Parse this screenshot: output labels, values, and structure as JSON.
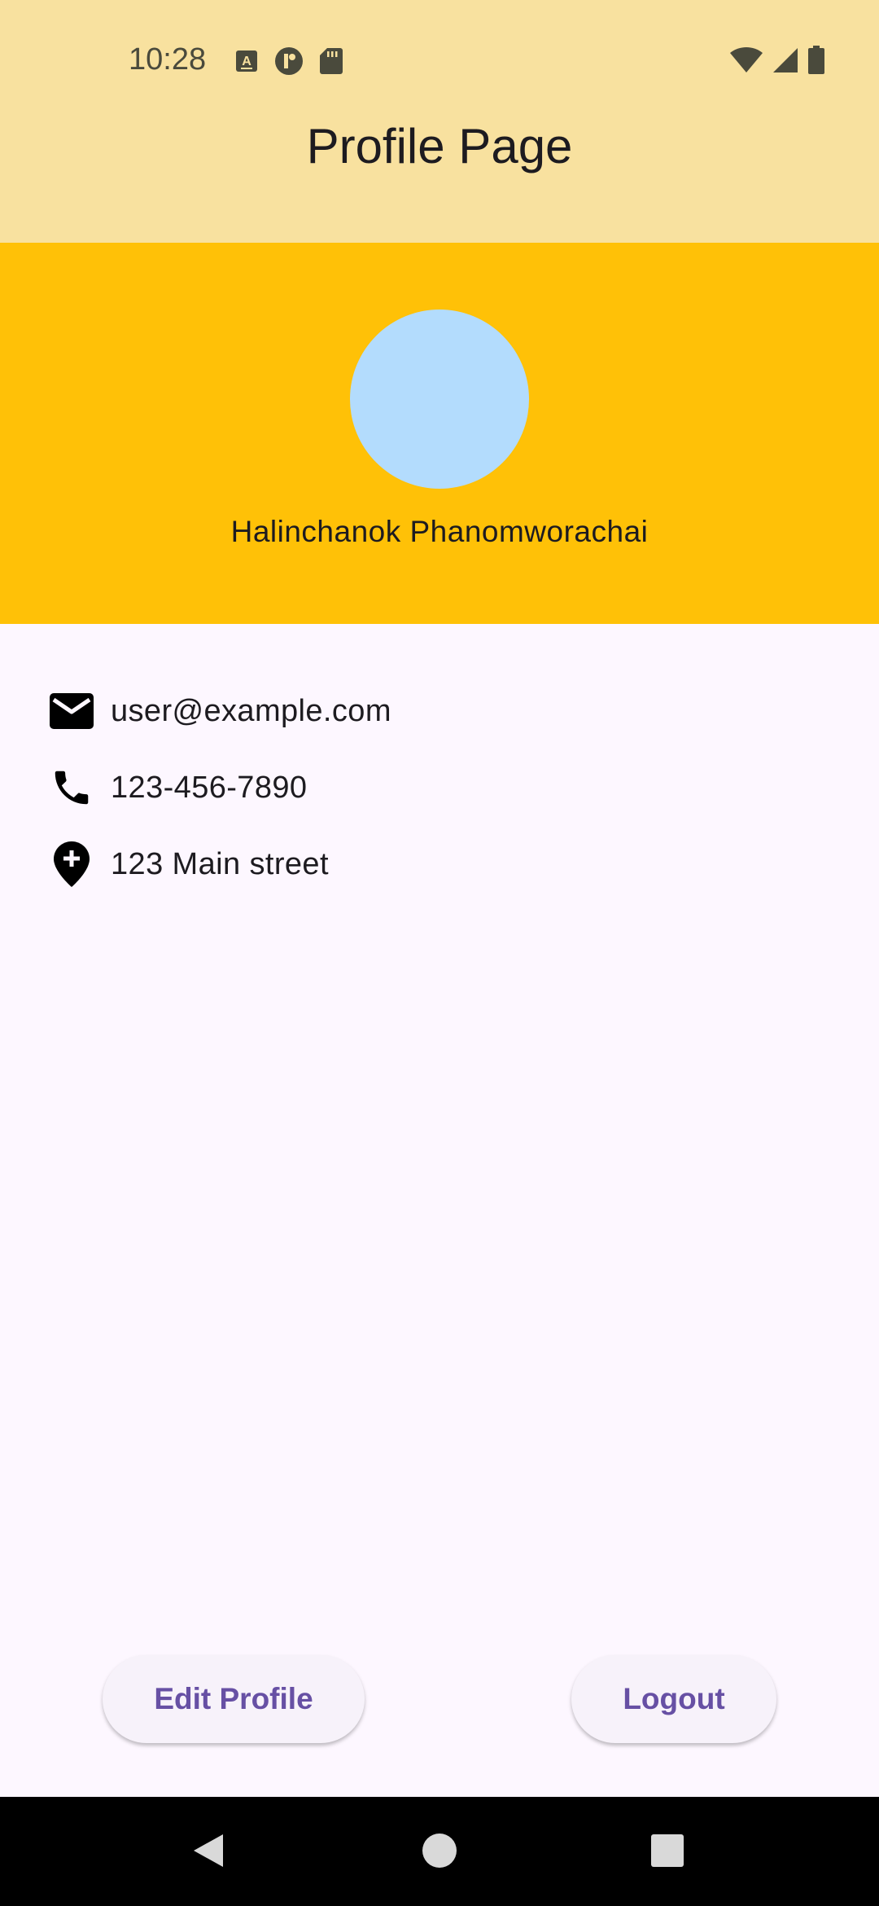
{
  "status_bar": {
    "time": "10:28",
    "left_icons": [
      "keyboard-icon",
      "app-badge-icon",
      "sd-card-icon"
    ],
    "right_icons": [
      "wifi-icon",
      "signal-icon",
      "battery-icon"
    ]
  },
  "app_bar": {
    "title": "Profile Page"
  },
  "profile": {
    "name": "Halinchanok Phanomworachai",
    "avatar_color": "#b3dcfd",
    "header_color": "#ffc107"
  },
  "contact": [
    {
      "icon": "mail-icon",
      "text": "user@example.com"
    },
    {
      "icon": "phone-icon",
      "text": "123-456-7890"
    },
    {
      "icon": "add-location-icon",
      "text": "123 Main street"
    }
  ],
  "actions": {
    "edit_label": "Edit Profile",
    "logout_label": "Logout"
  },
  "nav": {
    "buttons": [
      "back-icon",
      "home-icon",
      "recents-icon"
    ]
  },
  "colors": {
    "app_bar": "#f8e19f",
    "accent": "#6750a4",
    "background": "#fdf7ff"
  }
}
